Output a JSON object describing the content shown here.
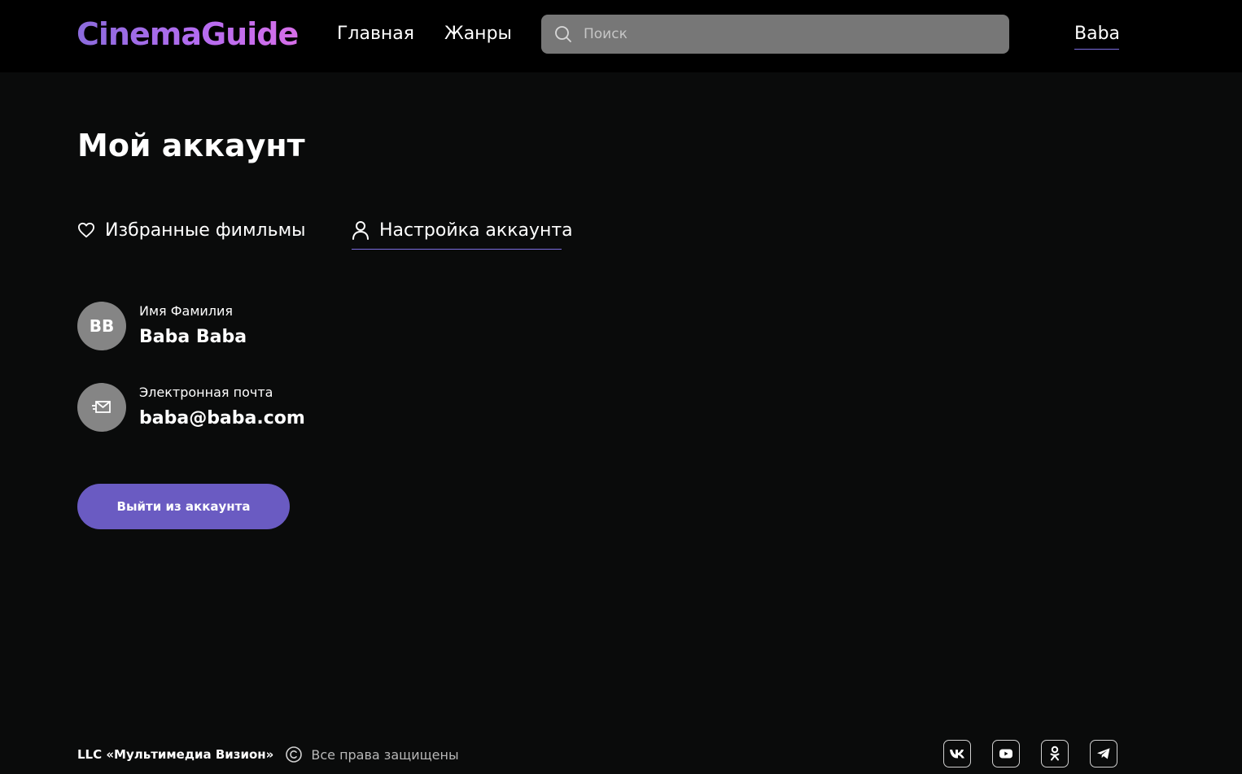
{
  "header": {
    "logo": "CinemaGuide",
    "nav": [
      {
        "label": "Главная"
      },
      {
        "label": "Жанры"
      }
    ],
    "search": {
      "placeholder": "Поиск",
      "value": ""
    },
    "user_name": "Baba"
  },
  "page": {
    "title": "Мой аккаунт"
  },
  "tabs": [
    {
      "label": "Избранные фимльмы",
      "icon": "heart-icon",
      "active": false
    },
    {
      "label": "Настройка аккаунта",
      "icon": "user-icon",
      "active": true
    }
  ],
  "account": {
    "avatar_initials": "BB",
    "name_label": "Имя Фамилия",
    "name_value": "Baba Baba",
    "email_label": "Электронная почта",
    "email_value": "baba@baba.com",
    "email_icon": "mail-icon"
  },
  "logout_label": "Выйти из аккаунта",
  "footer": {
    "company": "LLC «Мультимедиа Визион»",
    "copyright_icon": "copyright-icon",
    "rights": "Все права защищены",
    "social": [
      "vk-icon",
      "youtube-icon",
      "odnoklassniki-icon",
      "telegram-icon"
    ]
  },
  "colors": {
    "background": "#0a0b0b",
    "header": "#000000",
    "accent": "#6a5bc2",
    "underline": "#7b6ee0",
    "search_bg": "#777777"
  }
}
